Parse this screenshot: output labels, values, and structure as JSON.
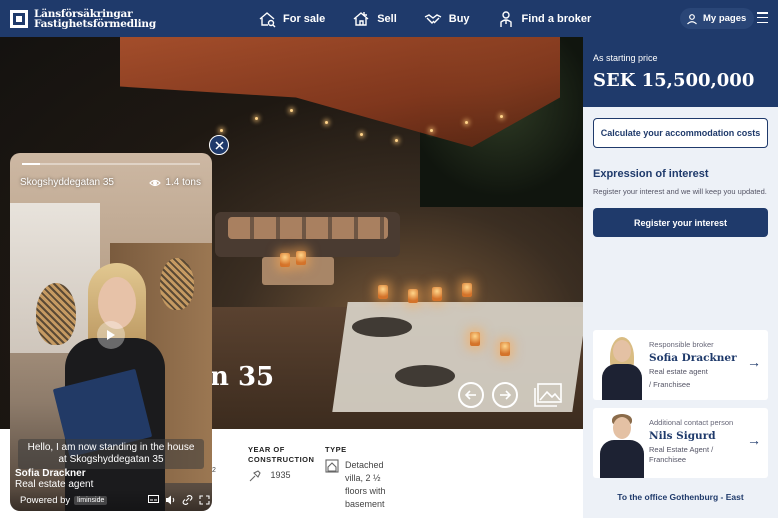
{
  "brand": {
    "line1": "Länsförsäkringar",
    "line2": "Fastighetsförmedling"
  },
  "nav": {
    "for_sale": "For sale",
    "sell": "Sell",
    "buy": "Buy",
    "find_broker": "Find a broker"
  },
  "account": {
    "my_pages": "My pages"
  },
  "hero": {
    "title_fragment": "n 35"
  },
  "video": {
    "address": "Skogshyddegatan 35",
    "views": "1.4 tons",
    "caption": "Hello, I am now standing in the house at Skogshyddegatan 35",
    "presenter_name": "Sofia Drackner",
    "presenter_role": "Real estate agent",
    "powered_by": "Powered by",
    "powered_brand": "liminside",
    "progress": 0.1
  },
  "details": {
    "partial_unit": "2",
    "year_heading_1": "YEAR OF",
    "year_heading_2": "CONSTRUCTION",
    "year": "1935",
    "type_heading": "TYPE",
    "type_line1": "Detached",
    "type_line2": "villa, 2 ½",
    "type_line3": "floors with",
    "type_line4": "basement"
  },
  "sidebar": {
    "price_label": "As starting price",
    "price": "SEK 15,500,000",
    "calc_button": "Calculate your accommodation costs",
    "interest_title": "Expression of interest",
    "interest_desc": "Register your interest and we will keep you updated.",
    "register_button": "Register your interest",
    "broker": {
      "role": "Responsible broker",
      "name": "Sofia Drackner",
      "line1": "Real estate agent",
      "line2": "/ Franchisee"
    },
    "contact": {
      "role": "Additional contact person",
      "name": "Nils Sigurd",
      "line1": "Real Estate Agent /",
      "line2": "Franchisee"
    },
    "office_link": "To the office Gothenburg - East",
    "arrow": "→"
  },
  "colors": {
    "navy": "#1f3a6b",
    "sidebar_bg": "#edf1f7"
  }
}
